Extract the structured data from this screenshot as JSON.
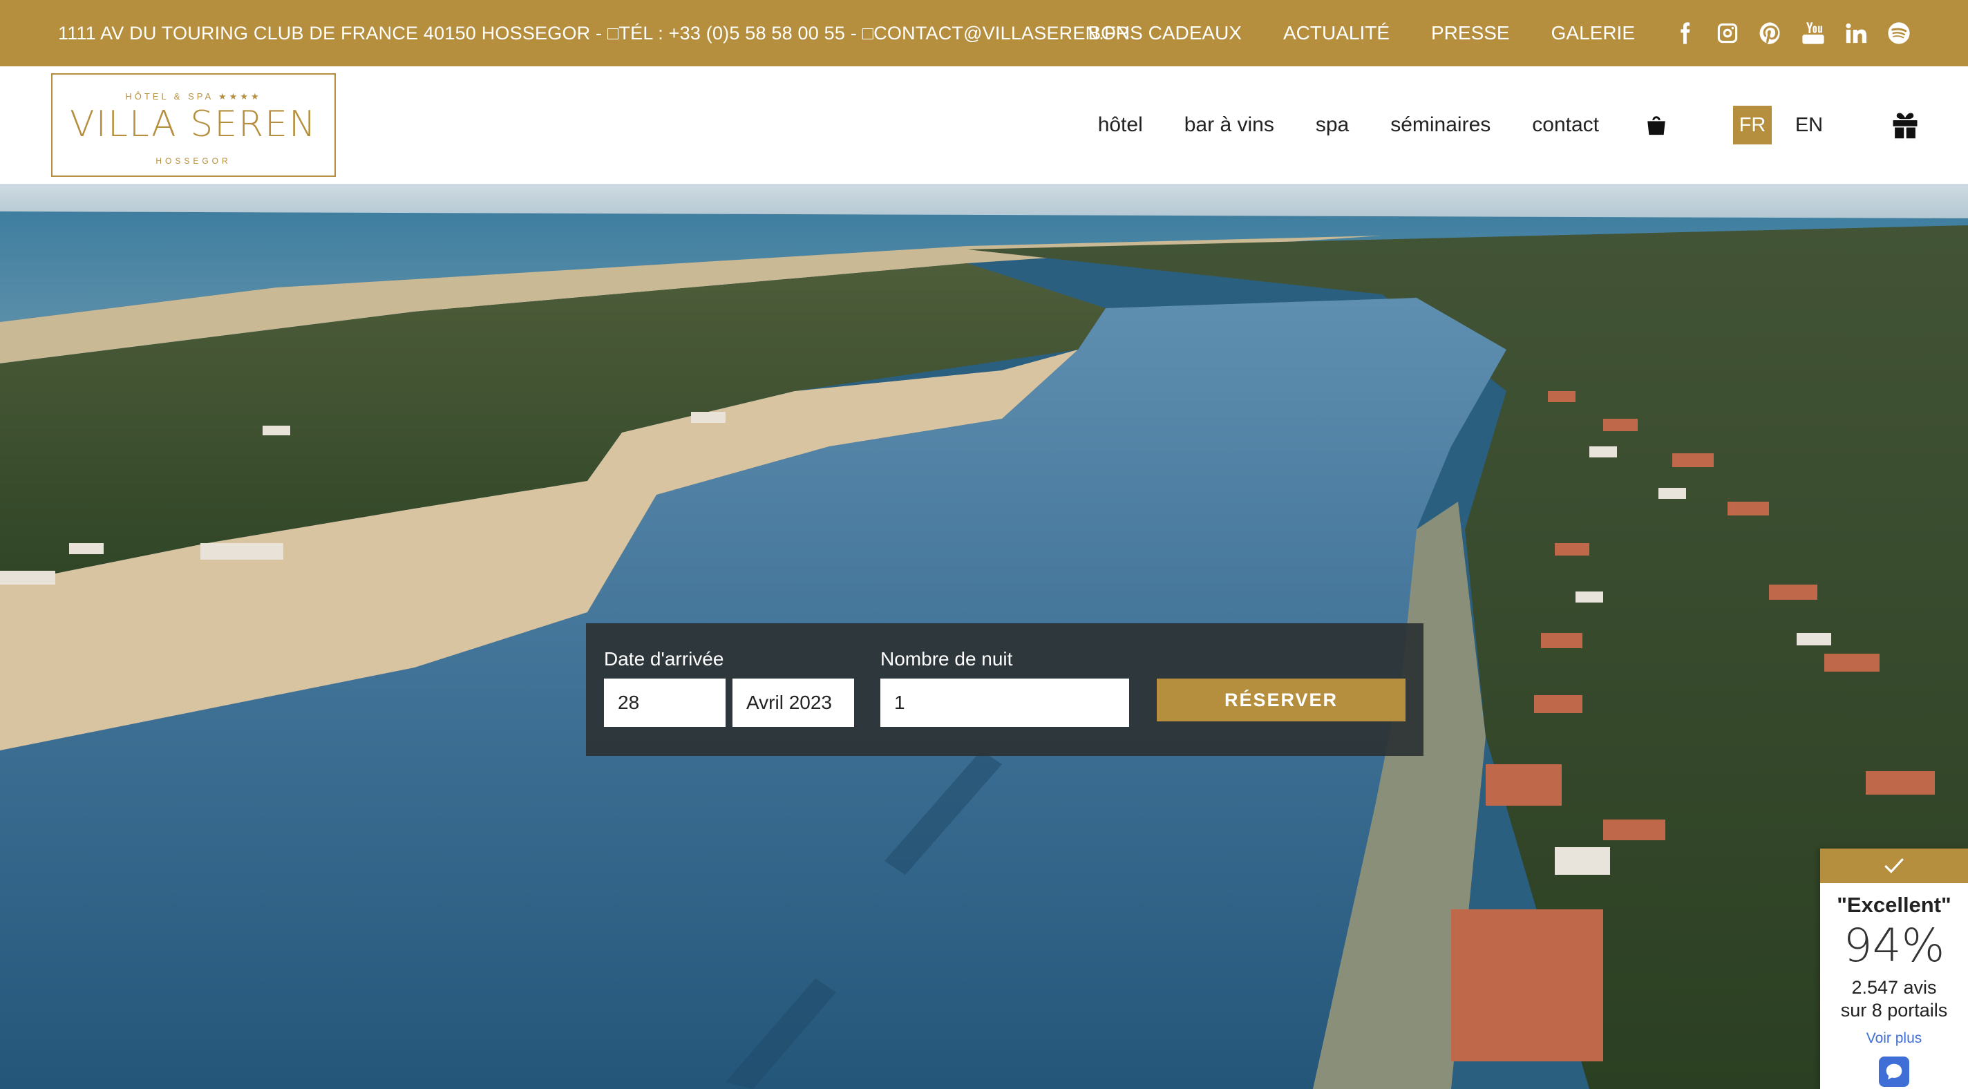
{
  "topbar": {
    "address": "1111 AV DU TOURING CLUB DE FRANCE 40150 HOSSEGOR - □TÉL : +33 (0)5 58 58 00 55 - □CONTACT@VILLASEREN.FR",
    "links": [
      "BONS CADEAUX",
      "ACTUALITÉ",
      "PRESSE",
      "GALERIE"
    ],
    "social_icons": [
      "facebook-icon",
      "instagram-icon",
      "pinterest-icon",
      "youtube-icon",
      "linkedin-icon",
      "spotify-icon"
    ]
  },
  "logo": {
    "top": "HÔTEL & SPA ★★★★",
    "name": "VILLA SEREN",
    "bottom": "HOSSEGOR"
  },
  "nav": {
    "items": [
      "hôtel",
      "bar à vins",
      "spa",
      "séminaires",
      "contact"
    ],
    "languages": [
      "FR",
      "EN"
    ],
    "active_language": "FR"
  },
  "booking": {
    "arrival_label": "Date d'arrivée",
    "day_value": "28",
    "month_value": "Avril 2023",
    "nights_label": "Nombre de nuit",
    "nights_value": "1",
    "button_label": "RÉSERVER"
  },
  "rating": {
    "label": "\"Excellent\"",
    "score": "94%",
    "reviews": "2.547 avis",
    "portals": "sur 8 portails",
    "more": "Voir plus"
  },
  "colors": {
    "gold": "#b58f3e",
    "widget_bg": "#2d3234",
    "link_blue": "#3f6fd6"
  }
}
